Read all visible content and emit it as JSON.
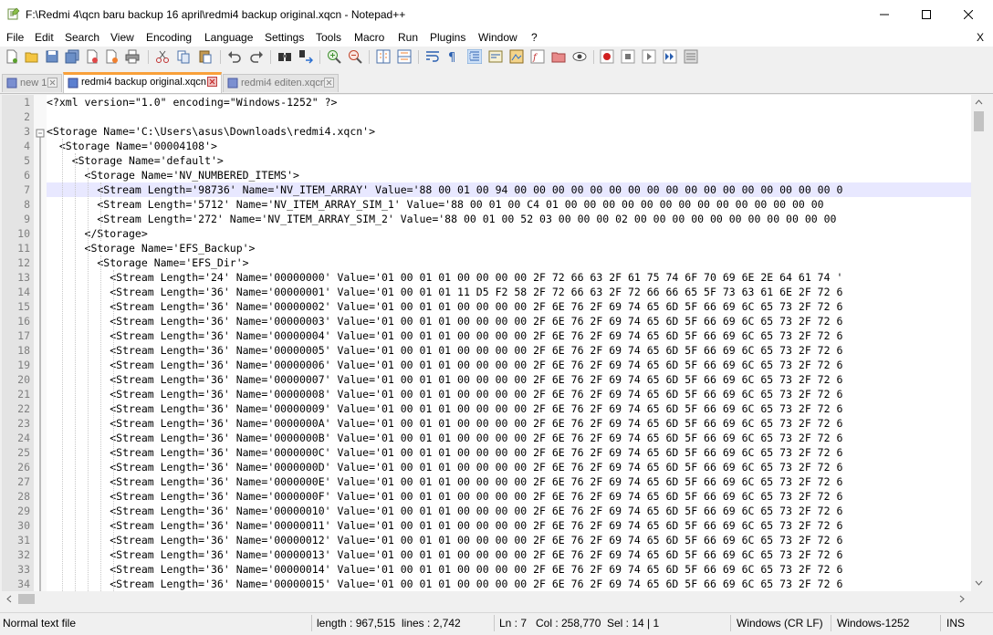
{
  "window": {
    "title": "F:\\Redmi 4\\qcn baru backup 16 april\\redmi4 backup original.xqcn - Notepad++",
    "icon": "notepadpp-icon"
  },
  "menu": [
    "File",
    "Edit",
    "Search",
    "View",
    "Encoding",
    "Language",
    "Settings",
    "Tools",
    "Macro",
    "Run",
    "Plugins",
    "Window",
    "?"
  ],
  "menu_close": "X",
  "toolbar": [
    "new-file-icon",
    "open-file-icon",
    "save-icon",
    "save-all-icon",
    "close-icon",
    "close-all-icon",
    "print-icon",
    "cut-icon",
    "copy-icon",
    "paste-icon",
    "undo-icon",
    "redo-icon",
    "find-icon",
    "replace-icon",
    "zoom-in-icon",
    "zoom-out-icon",
    "sync-vertical-icon",
    "sync-horizontal-icon",
    "word-wrap-icon",
    "show-all-chars-icon",
    "indent-guide-icon",
    "udl-icon",
    "doc-map-icon",
    "function-list-icon",
    "folder-workspace-icon",
    "monitoring-icon",
    "record-macro-icon",
    "stop-macro-icon",
    "play-macro-icon",
    "run-macro-multiple-icon",
    "save-macro-icon"
  ],
  "tabs": [
    {
      "label": "new 1",
      "active": false
    },
    {
      "label": "redmi4 backup original.xqcn",
      "active": true
    },
    {
      "label": "redmi4 editen.xqcn",
      "active": false
    }
  ],
  "editor": {
    "current_line": 7,
    "lines": [
      "<?xml version=\"1.0\" encoding=\"Windows-1252\" ?>",
      "",
      "<Storage Name='C:\\Users\\asus\\Downloads\\redmi4.xqcn'>",
      "  <Storage Name='00004108'>",
      "    <Storage Name='default'>",
      "      <Storage Name='NV_NUMBERED_ITEMS'>",
      "        <Stream Length='98736' Name='NV_ITEM_ARRAY' Value='88 00 01 00 94 00 00 00 00 00 00 00 00 00 00 00 00 00 00 00 00 00 0",
      "        <Stream Length='5712' Name='NV_ITEM_ARRAY_SIM_1' Value='88 00 01 00 C4 01 00 00 00 00 00 00 00 00 00 00 00 00 00 00",
      "        <Stream Length='272' Name='NV_ITEM_ARRAY_SIM_2' Value='88 00 01 00 52 03 00 00 00 02 00 00 00 00 00 00 00 00 00 00 00",
      "      </Storage>",
      "      <Storage Name='EFS_Backup'>",
      "        <Storage Name='EFS_Dir'>",
      "          <Stream Length='24' Name='00000000' Value='01 00 01 01 00 00 00 00 2F 72 66 63 2F 61 75 74 6F 70 69 6E 2E 64 61 74 '",
      "          <Stream Length='36' Name='00000001' Value='01 00 01 01 11 D5 F2 58 2F 72 66 63 2F 72 66 66 65 5F 73 63 61 6E 2F 72 6",
      "          <Stream Length='36' Name='00000002' Value='01 00 01 01 00 00 00 00 2F 6E 76 2F 69 74 65 6D 5F 66 69 6C 65 73 2F 72 6",
      "          <Stream Length='36' Name='00000003' Value='01 00 01 01 00 00 00 00 2F 6E 76 2F 69 74 65 6D 5F 66 69 6C 65 73 2F 72 6",
      "          <Stream Length='36' Name='00000004' Value='01 00 01 01 00 00 00 00 2F 6E 76 2F 69 74 65 6D 5F 66 69 6C 65 73 2F 72 6",
      "          <Stream Length='36' Name='00000005' Value='01 00 01 01 00 00 00 00 2F 6E 76 2F 69 74 65 6D 5F 66 69 6C 65 73 2F 72 6",
      "          <Stream Length='36' Name='00000006' Value='01 00 01 01 00 00 00 00 2F 6E 76 2F 69 74 65 6D 5F 66 69 6C 65 73 2F 72 6",
      "          <Stream Length='36' Name='00000007' Value='01 00 01 01 00 00 00 00 2F 6E 76 2F 69 74 65 6D 5F 66 69 6C 65 73 2F 72 6",
      "          <Stream Length='36' Name='00000008' Value='01 00 01 01 00 00 00 00 2F 6E 76 2F 69 74 65 6D 5F 66 69 6C 65 73 2F 72 6",
      "          <Stream Length='36' Name='00000009' Value='01 00 01 01 00 00 00 00 2F 6E 76 2F 69 74 65 6D 5F 66 69 6C 65 73 2F 72 6",
      "          <Stream Length='36' Name='0000000A' Value='01 00 01 01 00 00 00 00 2F 6E 76 2F 69 74 65 6D 5F 66 69 6C 65 73 2F 72 6",
      "          <Stream Length='36' Name='0000000B' Value='01 00 01 01 00 00 00 00 2F 6E 76 2F 69 74 65 6D 5F 66 69 6C 65 73 2F 72 6",
      "          <Stream Length='36' Name='0000000C' Value='01 00 01 01 00 00 00 00 2F 6E 76 2F 69 74 65 6D 5F 66 69 6C 65 73 2F 72 6",
      "          <Stream Length='36' Name='0000000D' Value='01 00 01 01 00 00 00 00 2F 6E 76 2F 69 74 65 6D 5F 66 69 6C 65 73 2F 72 6",
      "          <Stream Length='36' Name='0000000E' Value='01 00 01 01 00 00 00 00 2F 6E 76 2F 69 74 65 6D 5F 66 69 6C 65 73 2F 72 6",
      "          <Stream Length='36' Name='0000000F' Value='01 00 01 01 00 00 00 00 2F 6E 76 2F 69 74 65 6D 5F 66 69 6C 65 73 2F 72 6",
      "          <Stream Length='36' Name='00000010' Value='01 00 01 01 00 00 00 00 2F 6E 76 2F 69 74 65 6D 5F 66 69 6C 65 73 2F 72 6",
      "          <Stream Length='36' Name='00000011' Value='01 00 01 01 00 00 00 00 2F 6E 76 2F 69 74 65 6D 5F 66 69 6C 65 73 2F 72 6",
      "          <Stream Length='36' Name='00000012' Value='01 00 01 01 00 00 00 00 2F 6E 76 2F 69 74 65 6D 5F 66 69 6C 65 73 2F 72 6",
      "          <Stream Length='36' Name='00000013' Value='01 00 01 01 00 00 00 00 2F 6E 76 2F 69 74 65 6D 5F 66 69 6C 65 73 2F 72 6",
      "          <Stream Length='36' Name='00000014' Value='01 00 01 01 00 00 00 00 2F 6E 76 2F 69 74 65 6D 5F 66 69 6C 65 73 2F 72 6",
      "          <Stream Length='36' Name='00000015' Value='01 00 01 01 00 00 00 00 2F 6E 76 2F 69 74 65 6D 5F 66 69 6C 65 73 2F 72 6"
    ]
  },
  "status": {
    "file_type": "Normal text file",
    "length": "length : 967,515",
    "lines": "lines : 2,742",
    "ln": "Ln : 7",
    "col": "Col : 258,770",
    "sel": "Sel : 14 | 1",
    "eol": "Windows (CR LF)",
    "encoding": "Windows-1252",
    "mode": "INS"
  }
}
